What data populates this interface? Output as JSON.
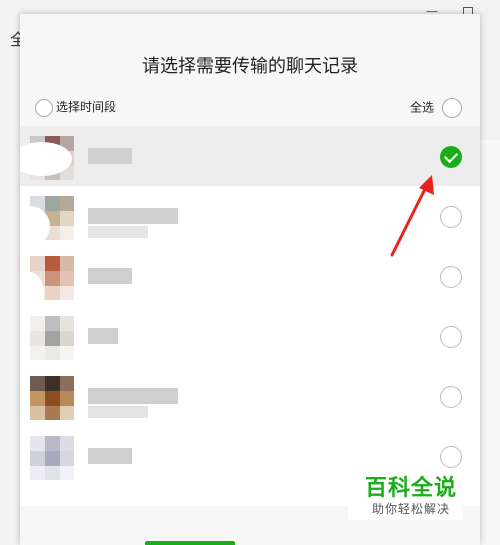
{
  "background": {
    "left_char": "全",
    "minimize_glyph": "—"
  },
  "dialog": {
    "title": "请选择需要传输的聊天记录",
    "time_range_label": "选择时间段",
    "select_all_label": "全选",
    "colors": {
      "accent": "#1aad19",
      "arrow": "#e5231b"
    }
  },
  "list": {
    "items": [
      {
        "selected": true,
        "avatar_colors": [
          "#c9c9c9",
          "#8a5a55",
          "#b7a7a0",
          "#d0c9c5",
          "#9e7d77",
          "#d9d2ce",
          "#e9e4e1",
          "#c8bfbb",
          "#e3dcd8"
        ]
      },
      {
        "selected": false,
        "avatar_colors": [
          "#d7dde0",
          "#9aa8a0",
          "#b3a99a",
          "#dbc7b1",
          "#c7b193",
          "#e4d6c1",
          "#f1ece6",
          "#e8e0d5",
          "#f3efea"
        ]
      },
      {
        "selected": false,
        "avatar_colors": [
          "#e7d3cb",
          "#b85a3d",
          "#d8b8a8",
          "#f0ddd4",
          "#c9937e",
          "#e2c2b4",
          "#f6ebe6",
          "#e9d2c6",
          "#f5e8e2"
        ]
      },
      {
        "selected": false,
        "avatar_colors": [
          "#f2f0ec",
          "#bdbdbd",
          "#e6e3df",
          "#e8e6e1",
          "#a3a3a3",
          "#d9d6d1",
          "#f4f2ef",
          "#ebe9e5",
          "#f6f5f2"
        ]
      },
      {
        "selected": false,
        "avatar_colors": [
          "#6e5a50",
          "#3e2f27",
          "#8a6f5a",
          "#c29561",
          "#8a4e22",
          "#b88a5a",
          "#d9c1a3",
          "#a87b52",
          "#e0cdb5"
        ]
      },
      {
        "selected": false,
        "avatar_colors": [
          "#e6e6ee",
          "#b9b9c9",
          "#dcdce6",
          "#cfcfdc",
          "#a9a9bd",
          "#d7d7e2",
          "#ececf2",
          "#e1e1ea",
          "#f1f1f5"
        ]
      }
    ]
  },
  "watermark": {
    "title": "百科全说",
    "subtitle": "助你轻松解决"
  }
}
